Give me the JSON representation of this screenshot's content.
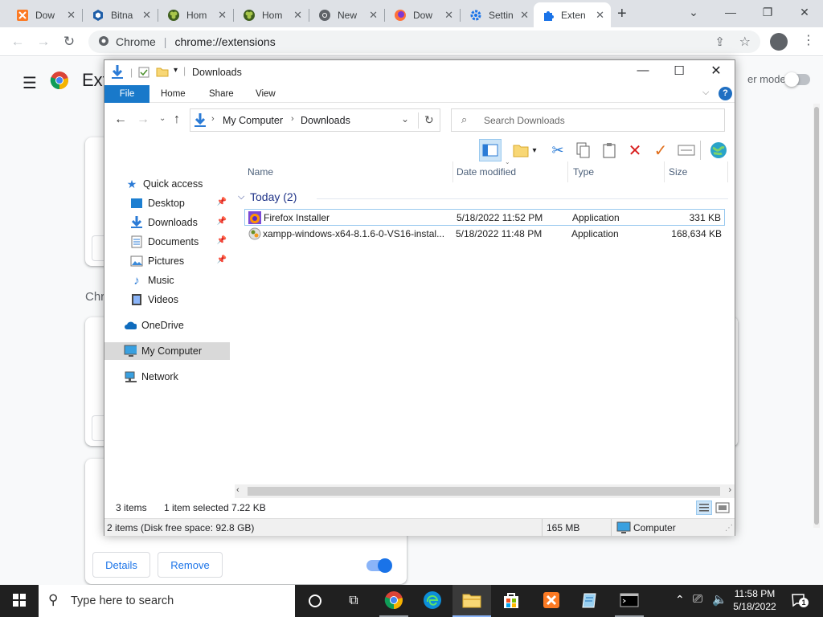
{
  "chrome": {
    "tabs": [
      {
        "label": "Dow",
        "icon": "xampp-icon",
        "color": "#fb7a24"
      },
      {
        "label": "Bitna",
        "icon": "bitnami-icon",
        "color": "#1e5ea8"
      },
      {
        "label": "Hom",
        "icon": "xampp-clover-icon",
        "color": "#6b8e23"
      },
      {
        "label": "Hom",
        "icon": "xampp-clover-icon",
        "color": "#6b8e23"
      },
      {
        "label": "New",
        "icon": "chrome-icon",
        "color": "#5f6368"
      },
      {
        "label": "Dow",
        "icon": "firefox-icon",
        "color": "#ff7139"
      },
      {
        "label": "Settin",
        "icon": "gear-icon",
        "color": "#1a73e8"
      },
      {
        "label": "Exten",
        "icon": "puzzle-icon",
        "color": "#1a73e8",
        "active": true
      }
    ],
    "omnibox": {
      "site": "Chrome",
      "url": "chrome://extensions"
    }
  },
  "extensions_page": {
    "title": "Ext",
    "dev_mode_label": "er mode",
    "section_label": "Chr",
    "details_label": "Details",
    "remove_label": "Remove"
  },
  "explorer": {
    "title": "Downloads",
    "ribbon_tabs": [
      "File",
      "Home",
      "Share",
      "View"
    ],
    "breadcrumb": [
      "My Computer",
      "Downloads"
    ],
    "search_placeholder": "Search Downloads",
    "nav": {
      "quick_access": "Quick access",
      "pinned": [
        {
          "label": "Desktop",
          "icon": "desktop-icon",
          "pinned": true
        },
        {
          "label": "Downloads",
          "icon": "downloads-arrow-icon",
          "pinned": true
        },
        {
          "label": "Documents",
          "icon": "documents-icon",
          "pinned": true
        },
        {
          "label": "Pictures",
          "icon": "pictures-icon",
          "pinned": true
        },
        {
          "label": "Music",
          "icon": "music-note-icon",
          "pinned": false
        },
        {
          "label": "Videos",
          "icon": "videos-icon",
          "pinned": false
        }
      ],
      "onedrive": "OneDrive",
      "my_computer": "My Computer",
      "network": "Network"
    },
    "columns": {
      "name": "Name",
      "date": "Date modified",
      "type": "Type",
      "size": "Size"
    },
    "group_label": "Today (2)",
    "files": [
      {
        "name": "Firefox Installer",
        "date": "5/18/2022 11:52 PM",
        "type": "Application",
        "size": "331 KB",
        "icon": "firefox-installer-icon"
      },
      {
        "name": "xampp-windows-x64-8.1.6-0-VS16-instal...",
        "date": "5/18/2022 11:48 PM",
        "type": "Application",
        "size": "168,634 KB",
        "icon": "xampp-installer-icon"
      }
    ],
    "status": {
      "items": "3 items",
      "selected": "1 item selected",
      "selected_size": "7.22 KB"
    },
    "details_bar": {
      "summary": "2 items (Disk free space: 92.8 GB)",
      "size": "165 MB",
      "location": "Computer"
    }
  },
  "taskbar": {
    "search_placeholder": "Type here to search",
    "time": "11:58 PM",
    "date": "5/18/2022",
    "notification_count": "1"
  }
}
